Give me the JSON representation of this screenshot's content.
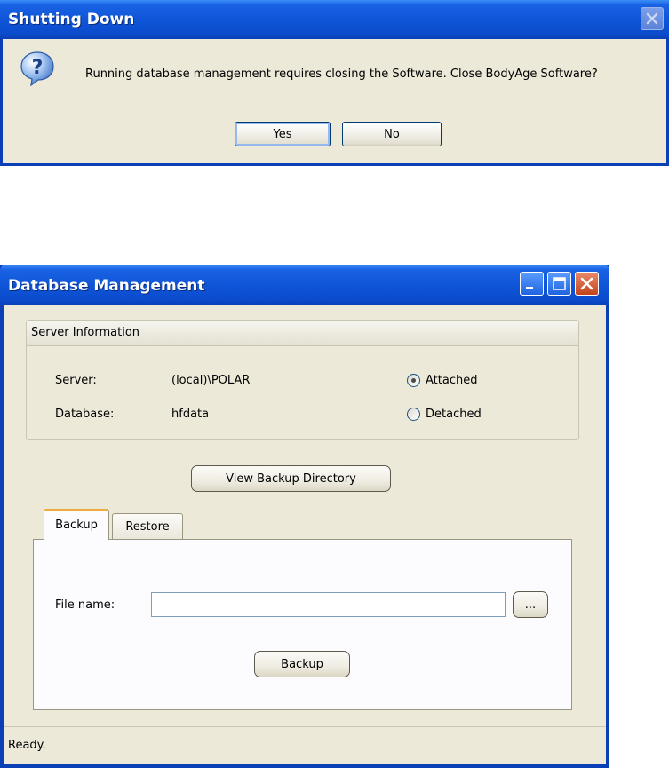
{
  "dialog": {
    "title": "Shutting Down",
    "icon": "question-icon",
    "message": "Running database management requires closing the Software. Close BodyAge Software?",
    "yes_label": "Yes",
    "no_label": "No"
  },
  "window": {
    "title": "Database Management",
    "server_info": {
      "heading": "Server Information",
      "server_label": "Server:",
      "server_value": "(local)\\POLAR",
      "database_label": "Database:",
      "database_value": "hfdata",
      "attached_label": "Attached",
      "detached_label": "Detached",
      "selected": "Attached"
    },
    "view_backup_label": "View Backup Directory",
    "tabs": [
      {
        "label": "Backup",
        "active": true
      },
      {
        "label": "Restore",
        "active": false
      }
    ],
    "backup_panel": {
      "file_name_label": "File name:",
      "file_name_value": "",
      "browse_label": "...",
      "backup_label": "Backup"
    },
    "status": "Ready."
  },
  "colors": {
    "titlebar": "#0f55d8",
    "dialog_bg": "#ece9d8",
    "active_tab_accent": "#f0a93c"
  }
}
